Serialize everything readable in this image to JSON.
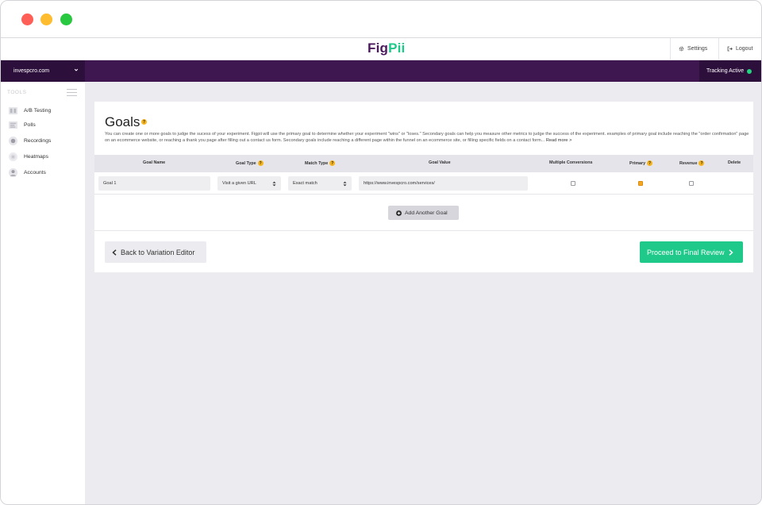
{
  "brand": {
    "part1": "Fig",
    "part2": "Pii"
  },
  "header": {
    "settings_label": "Settings",
    "logout_label": "Logout"
  },
  "topbar": {
    "domain": "invespcro.com",
    "tracking_label": "Tracking Active"
  },
  "sidebar": {
    "section_label": "TOOLS",
    "items": [
      {
        "label": "A/B Testing",
        "icon": "ab-testing-icon"
      },
      {
        "label": "Polls",
        "icon": "polls-icon"
      },
      {
        "label": "Recordings",
        "icon": "recordings-icon"
      },
      {
        "label": "Heatmaps",
        "icon": "heatmaps-icon"
      },
      {
        "label": "Accounts",
        "icon": "accounts-icon"
      }
    ]
  },
  "goals": {
    "title": "Goals",
    "help": "?",
    "description": "You can create one or more goals to judge the sucess of your experiment. Figpii will use the primary goal to determine whether your experiment \"wins\" or \"loses.\" Secondary goals can help you measure other metrics to judge the success of the experiment. examples of primary goal include reaching the \"order confirmation\" page on an ecommerce website, or reaching a thank you page after filling out a contact us form. Secondary goals include reaching a different page within the funnel on an ecommerce site, or filling specific fields on a contact form...",
    "read_more": "Read more >",
    "columns": {
      "goal_name": "Goal Name",
      "goal_type": "Goal Type",
      "match_type": "Match Type",
      "goal_value": "Goal Value",
      "multiple_conversions": "Multiple Conversions",
      "primary": "Primary",
      "revenue": "Revenue",
      "delete": "Delete"
    },
    "rows": [
      {
        "name": "Goal 1",
        "type": "Visit a given URL",
        "match": "Exact match",
        "value": "https://www.invespcro.com/services/",
        "multiple_conversions": false,
        "primary": true,
        "revenue": false
      }
    ],
    "add_button": "Add Another Goal",
    "back_button": "Back to Variation Editor",
    "next_button": "Proceed to Final Review"
  },
  "colors": {
    "brand_purple": "#3e1650",
    "brand_green": "#1fc98a",
    "help_badge": "#f3b420",
    "tracking_dot": "#22d37f"
  }
}
